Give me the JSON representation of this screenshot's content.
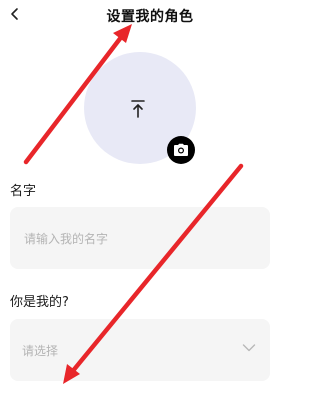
{
  "header": {
    "title": "设置我的角色"
  },
  "icons": {
    "back": "chevron-left-icon",
    "upload": "upload-icon",
    "camera": "camera-icon",
    "dropdown": "chevron-down-icon"
  },
  "form": {
    "name_label": "名字",
    "name_placeholder": "请输入我的名字",
    "name_value": "",
    "relation_label": "你是我的?",
    "relation_placeholder": "请选择"
  },
  "colors": {
    "avatar_bg": "#e8e9f6",
    "field_bg": "#f5f5f5",
    "placeholder": "#b4b4b4",
    "annotation_red": "#e8262a"
  }
}
